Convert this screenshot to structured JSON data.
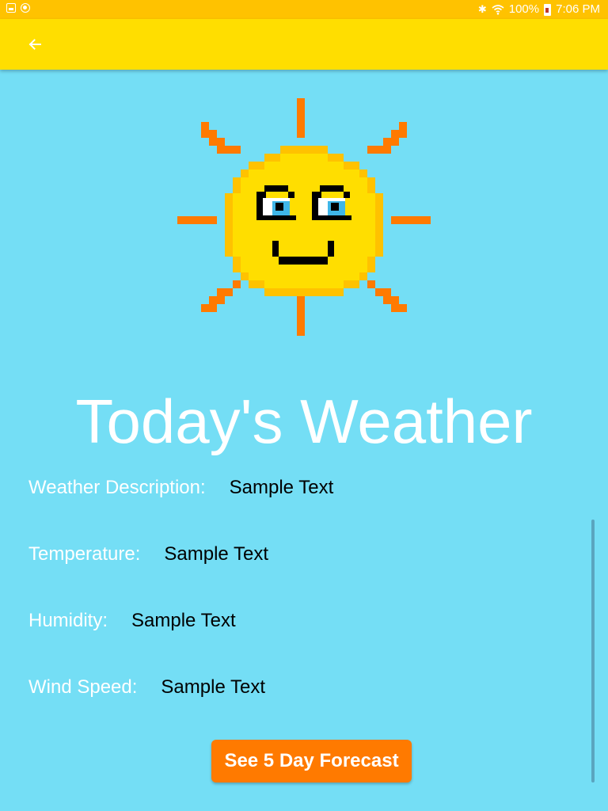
{
  "status_bar": {
    "battery_text": "100%",
    "time": "7:06 PM"
  },
  "app_bar": {
    "back_icon": "arrow-back-icon"
  },
  "main": {
    "title": "Today's Weather",
    "rows": [
      {
        "label": "Weather Description:",
        "value": "Sample Text"
      },
      {
        "label": "Temperature:",
        "value": "Sample Text"
      },
      {
        "label": "Humidity:",
        "value": "Sample Text"
      },
      {
        "label": "Wind Speed:",
        "value": "Sample Text"
      }
    ],
    "forecast_button_label": "See 5 Day Forecast"
  },
  "colors": {
    "status_bar": "#FFC200",
    "app_bar": "#FFDE00",
    "background": "#74DEF5",
    "button": "#FF7A00",
    "sun_body": "#FFDE00",
    "sun_outline": "#FFC200",
    "sun_rays": "#FF7A00"
  }
}
